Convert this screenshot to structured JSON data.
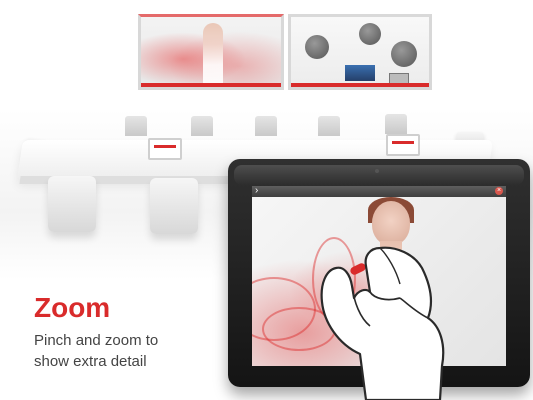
{
  "headline": "Zoom",
  "subtext": "Pinch and zoom to show extra detail",
  "colors": {
    "accent": "#d92b2b",
    "text": "#444444",
    "tablet_body": "#1f1f1f"
  },
  "tablet": {
    "toolbar": {
      "back_icon": "chevron-right-icon",
      "close_icon": "close-icon",
      "back_glyph": "›",
      "close_glyph": "×"
    }
  },
  "icons": [
    "chevron-right-icon",
    "close-icon",
    "pinch-hand-icon",
    "zoom-arrows-icon"
  ]
}
